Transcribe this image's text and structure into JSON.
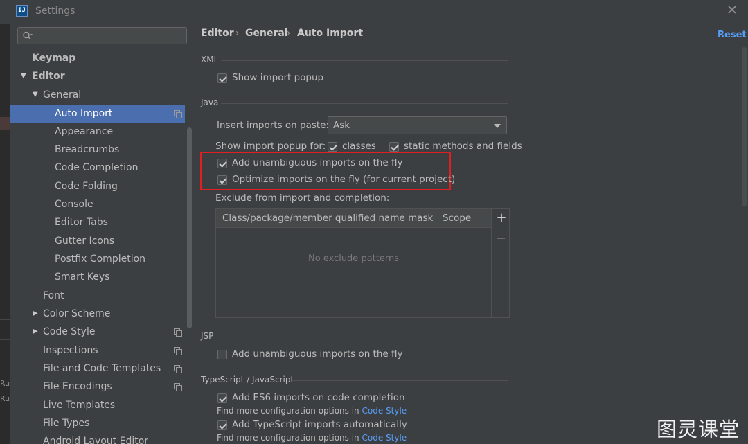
{
  "window": {
    "app_icon_text": "IJ",
    "title": "Settings"
  },
  "left_strip": {
    "rul1": "Rul",
    "rul2": "Rul"
  },
  "sidebar": {
    "search_placeholder": "Q-",
    "items": [
      {
        "label": "Keymap"
      },
      {
        "label": "Editor"
      },
      {
        "label": "General"
      },
      {
        "label": "Auto Import"
      },
      {
        "label": "Appearance"
      },
      {
        "label": "Breadcrumbs"
      },
      {
        "label": "Code Completion"
      },
      {
        "label": "Code Folding"
      },
      {
        "label": "Console"
      },
      {
        "label": "Editor Tabs"
      },
      {
        "label": "Gutter Icons"
      },
      {
        "label": "Postfix Completion"
      },
      {
        "label": "Smart Keys"
      },
      {
        "label": "Font"
      },
      {
        "label": "Color Scheme"
      },
      {
        "label": "Code Style"
      },
      {
        "label": "Inspections"
      },
      {
        "label": "File and Code Templates"
      },
      {
        "label": "File Encodings"
      },
      {
        "label": "Live Templates"
      },
      {
        "label": "File Types"
      },
      {
        "label": "Android Layout Editor"
      }
    ]
  },
  "breadcrumb": {
    "items": [
      "Editor",
      "General",
      "Auto Import"
    ],
    "separator": "›"
  },
  "reset_label": "Reset",
  "xml": {
    "title": "XML",
    "show_import_popup": "Show import popup"
  },
  "java": {
    "title": "Java",
    "insert_label": "Insert imports on paste:",
    "insert_value": "Ask",
    "popup_for_label": "Show import popup for:",
    "classes": "classes",
    "static_methods": "static methods and fields",
    "add_unambiguous": "Add unambiguous imports on the fly",
    "optimize": "Optimize imports on the fly (for current project)",
    "exclude_label": "Exclude from import and completion:",
    "table": {
      "col_mask": "Class/package/member qualified name mask",
      "col_scope": "Scope",
      "empty": "No exclude patterns",
      "add": "+"
    }
  },
  "jsp": {
    "title": "JSP",
    "add_unambiguous": "Add unambiguous imports on the fly"
  },
  "ts": {
    "title": "TypeScript / JavaScript",
    "es6": "Add ES6 imports on code completion",
    "hint1_prefix": "Find more configuration options in ",
    "hint1_link": "Code Style",
    "ts_auto": "Add TypeScript imports automatically",
    "hint2_prefix": "Find more configuration options in ",
    "hint2_link": "Code Style"
  },
  "watermark": "图灵课堂",
  "colors": {
    "accent": "#4b6eaf",
    "link": "#589df6",
    "highlight": "#e02020",
    "background": "#3c3f41"
  }
}
